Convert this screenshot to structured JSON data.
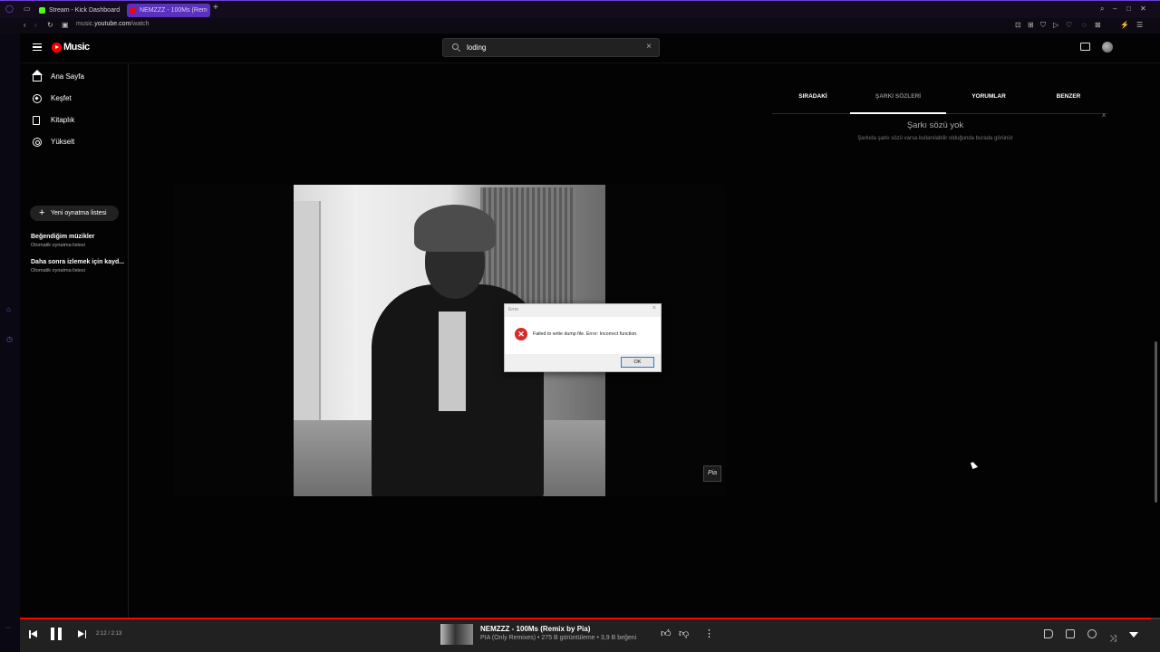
{
  "browser": {
    "tabs": [
      {
        "title": "Stream - Kick Dashboard"
      },
      {
        "title": "NEMZZZ - 100Ms (Rem"
      }
    ],
    "new_tab": "+",
    "url_prefix": "music.",
    "url_domain": "youtube.com",
    "url_path": "/watch"
  },
  "header": {
    "logo": "Music",
    "search_value": "loding",
    "search_clear": "×"
  },
  "sidebar": {
    "items": [
      {
        "label": "Ana Sayfa",
        "icon": "home-icon"
      },
      {
        "label": "Keşfet",
        "icon": "compass-icon"
      },
      {
        "label": "Kitaplık",
        "icon": "library-icon"
      },
      {
        "label": "Yükselt",
        "icon": "upgrade-icon"
      }
    ],
    "new_playlist": "Yeni oynatma listesi",
    "playlists": [
      {
        "title": "Beğendiğim müzikler",
        "subtitle": "Otomatik oynatma listesi"
      },
      {
        "title": "Daha sonra izlemek için kayd...",
        "subtitle": "Otomatik oynatma listesi"
      }
    ]
  },
  "video": {
    "watermark": "Pia"
  },
  "dialog": {
    "title": "Error",
    "close": "×",
    "message": "Failed to write dump file. Error: Incorrect function.",
    "ok_label": "OK"
  },
  "right_panel": {
    "tabs": [
      "SIRADAKİ",
      "ŞARKI SÖZLERİ",
      "YORUMLAR",
      "BENZER"
    ],
    "active_tab": "ŞARKI SÖZLERİ",
    "no_lyrics_title": "Şarkı sözü yok",
    "no_lyrics_subtitle": "Şarkıda şarkı sözü varsa kullanılabilir olduğunda burada görünür"
  },
  "player": {
    "time": "2:12 / 2:13",
    "progress": 0.992,
    "title": "NEMZZZ - 100Ms (Remix by Pia)",
    "subtitle": "PIA (Only Remixes) • 275 B görüntüleme • 3,9 B beğeni"
  },
  "colors": {
    "accent": "#ff0000",
    "browser_accent": "#5a2fc2",
    "background": "#030303",
    "player_bg": "#212121"
  }
}
